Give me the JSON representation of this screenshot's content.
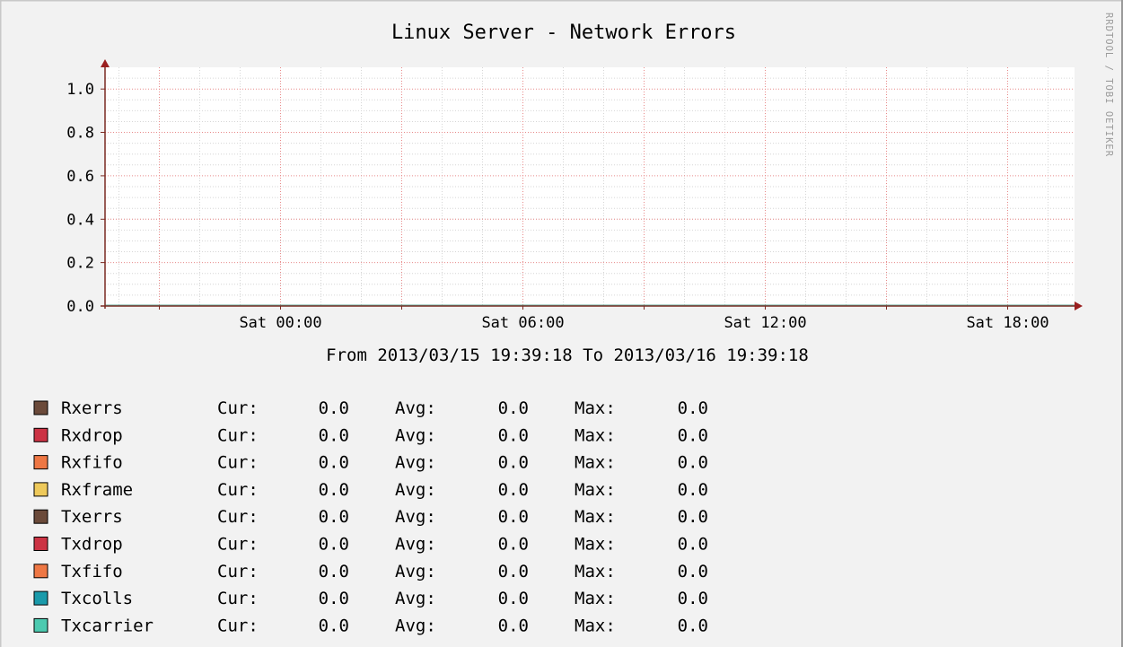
{
  "chart_data": {
    "type": "line",
    "title": "Linux Server - Network Errors",
    "subtitle": "From 2013/03/15 19:39:18 To 2013/03/16 19:39:18",
    "watermark": "RRDTOOL / TOBI OETIKER",
    "x": {
      "range": [
        "2013-03-15 19:39:18",
        "2013-03-16 19:39:18"
      ],
      "ticks": [
        {
          "label": "Sat 00:00",
          "value": "2013-03-16 00:00"
        },
        {
          "label": "Sat 06:00",
          "value": "2013-03-16 06:00"
        },
        {
          "label": "Sat 12:00",
          "value": "2013-03-16 12:00"
        },
        {
          "label": "Sat 18:00",
          "value": "2013-03-16 18:00"
        }
      ]
    },
    "y": {
      "range": [
        0,
        1.1
      ],
      "ticks": [
        {
          "label": "0.0",
          "value": 0.0
        },
        {
          "label": "0.2",
          "value": 0.2
        },
        {
          "label": "0.4",
          "value": 0.4
        },
        {
          "label": "0.6",
          "value": 0.6
        },
        {
          "label": "0.8",
          "value": 0.8
        },
        {
          "label": "1.0",
          "value": 1.0
        }
      ]
    },
    "grid": true,
    "legend_position": "bottom",
    "stat_labels": {
      "cur": "Cur:",
      "avg": "Avg:",
      "max": "Max:"
    },
    "series": [
      {
        "name": "Rxerrs",
        "color": "#6b4a3a",
        "values": [
          0.0,
          0.0
        ],
        "cur": "0.0",
        "avg": "0.0",
        "max": "0.0"
      },
      {
        "name": "Rxdrop",
        "color": "#cc3344",
        "values": [
          0.0,
          0.0
        ],
        "cur": "0.0",
        "avg": "0.0",
        "max": "0.0"
      },
      {
        "name": "Rxfifo",
        "color": "#ee7744",
        "values": [
          0.0,
          0.0
        ],
        "cur": "0.0",
        "avg": "0.0",
        "max": "0.0"
      },
      {
        "name": "Rxframe",
        "color": "#eec95a",
        "values": [
          0.0,
          0.0
        ],
        "cur": "0.0",
        "avg": "0.0",
        "max": "0.0"
      },
      {
        "name": "Txerrs",
        "color": "#6b4a3a",
        "values": [
          0.0,
          0.0
        ],
        "cur": "0.0",
        "avg": "0.0",
        "max": "0.0"
      },
      {
        "name": "Txdrop",
        "color": "#cc3344",
        "values": [
          0.0,
          0.0
        ],
        "cur": "0.0",
        "avg": "0.0",
        "max": "0.0"
      },
      {
        "name": "Txfifo",
        "color": "#ee7744",
        "values": [
          0.0,
          0.0
        ],
        "cur": "0.0",
        "avg": "0.0",
        "max": "0.0"
      },
      {
        "name": "Txcolls",
        "color": "#1a9aaa",
        "values": [
          0.0,
          0.0
        ],
        "cur": "0.0",
        "avg": "0.0",
        "max": "0.0"
      },
      {
        "name": "Txcarrier",
        "color": "#4ccab0",
        "values": [
          0.0,
          0.0
        ],
        "cur": "0.0",
        "avg": "0.0",
        "max": "0.0"
      }
    ]
  }
}
